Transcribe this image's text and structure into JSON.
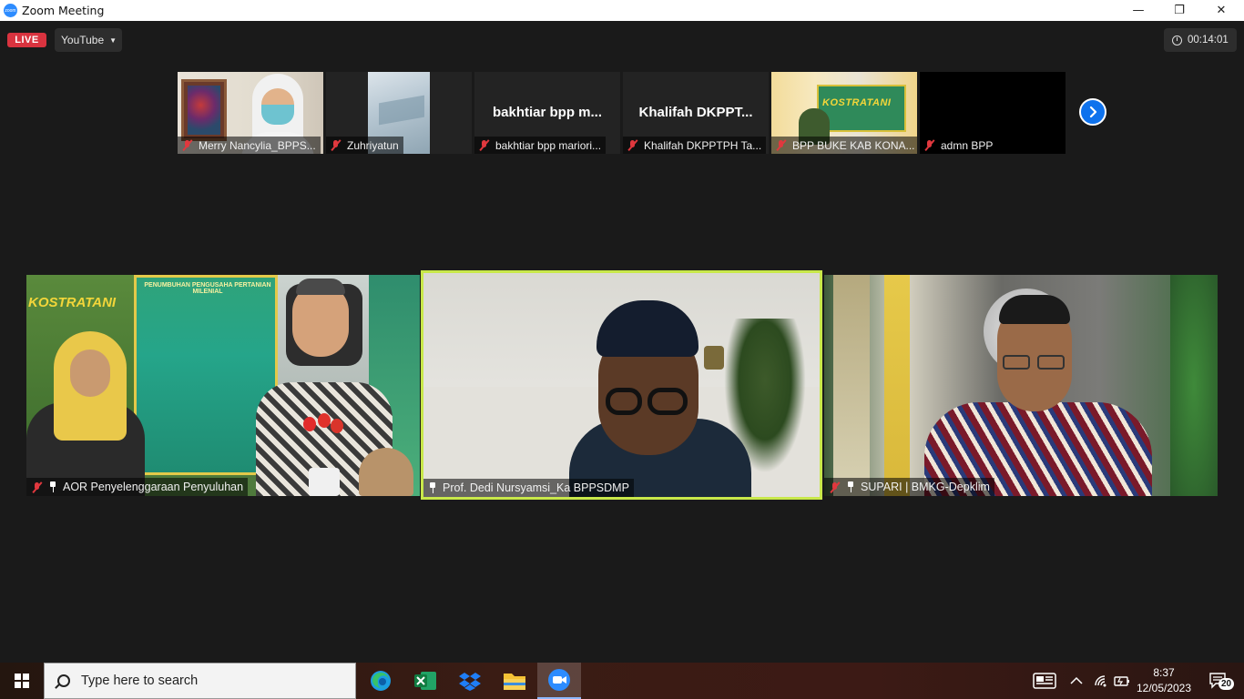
{
  "window": {
    "title": "Zoom Meeting",
    "controls": {
      "minimize": "—",
      "restore": "❐",
      "close": "✕"
    }
  },
  "meeting": {
    "live_label": "LIVE",
    "platform": "YouTube",
    "elapsed": "00:14:01"
  },
  "thumbnails": [
    {
      "name": "Merry Nancylia_BPPS...",
      "muted": true,
      "video": true
    },
    {
      "name": "Zuhriyatun",
      "muted": true,
      "video": true
    },
    {
      "name": "bakhtiar bpp mariori...",
      "big_name": "bakhtiar  bpp  m...",
      "muted": true,
      "video": false
    },
    {
      "name": "Khalifah DKPPTPH Ta...",
      "big_name": "Khalifah  DKPPT...",
      "muted": true,
      "video": false
    },
    {
      "name": "BPP BUKE KAB KONA...",
      "muted": true,
      "video": true
    },
    {
      "name": "admn BPP",
      "muted": true,
      "video": false
    }
  ],
  "main_videos": [
    {
      "name": "AOR Penyelenggaraan Penyuluhan",
      "muted": true,
      "pinned": true
    },
    {
      "name": "Prof. Dedi Nursyamsi_Ka BPPSDMP",
      "muted": false,
      "pinned": true,
      "active_speaker": true
    },
    {
      "name": "SUPARI | BMKG-Depklim",
      "muted": true,
      "pinned": true
    }
  ],
  "scene_text": {
    "banner_left": "KOSTRATANI",
    "banner_poster": "PENUMBUHAN PENGUSAHA PERTANIAN MILENIAL",
    "thumb_banner": "KOSTRATANI"
  },
  "taskbar": {
    "search_placeholder": "Type here to search",
    "time": "8:37",
    "date": "12/05/2023",
    "notification_count": "20",
    "apps": [
      "edge-icon",
      "excel-icon",
      "dropbox-icon",
      "file-explorer-icon",
      "zoom-icon"
    ]
  },
  "colors": {
    "live_red": "#d9333f",
    "active_speaker_border": "#c8e84a",
    "zoom_blue": "#0e72ed",
    "muted_red": "#e0383e"
  }
}
